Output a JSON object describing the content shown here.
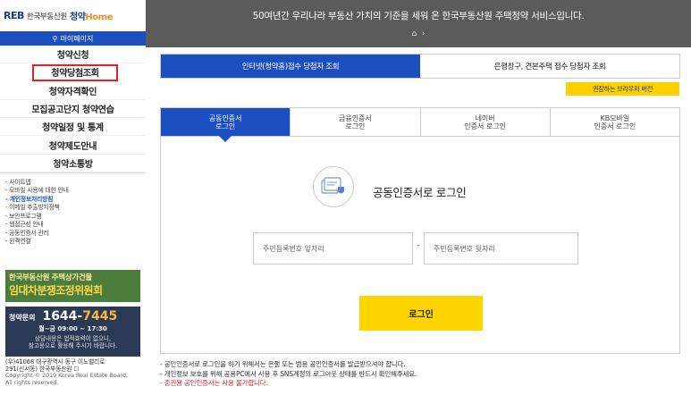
{
  "logo": {
    "mark": "REB",
    "agency": "한국부동산원",
    "brand_a": "청약",
    "brand_b": "Home"
  },
  "sidebar": {
    "mypage_label": "마이페이지",
    "menu": [
      {
        "label": "청약신청"
      },
      {
        "label": "청약당첨조회",
        "active": true
      },
      {
        "label": "청약자격확인"
      },
      {
        "label": "모집공고단지 청약연습"
      },
      {
        "label": "청약일정 및 통계"
      },
      {
        "label": "청약제도안내"
      },
      {
        "label": "청약소통방"
      }
    ],
    "links": [
      "사이트맵",
      "모바일 사용에 대한 안내",
      "개인정보처리방침",
      "이메일 추출방지정책",
      "보안프로그램",
      "웹접근성 안내",
      "공동인증서 관리",
      "원격연결"
    ],
    "banner": {
      "line1": "한국부동산원 주택상가건물",
      "line2": "임대차분쟁조정위원회"
    },
    "call": {
      "title": "청약문의",
      "num_a": "1644-",
      "num_b": "7445",
      "hours": "월~금 09:00 ~ 17:30",
      "note1": "상담내용은 법적효력이 없으니,",
      "note2": "참고용으로 활용해 주시기 바랍니다."
    },
    "address1": "(우)41068 대구광역시 동구 이노밸리로",
    "address2": "291(신서동) 한국부동산원 ☐",
    "copy1": "Copyright © 2019 Korea Real Estate Board,",
    "copy2": "All rights reserved."
  },
  "header": {
    "message": "50여년간 우리나라 부동산 가치의 기준을 세워 온 한국부동산원 주택청약 서비스입니다.",
    "home_icon": "home-icon"
  },
  "main": {
    "top_tabs": [
      {
        "label": "인터넷(청약홈)접수 당첨자 조회",
        "active": true
      },
      {
        "label": "은행창구, 견본주택 접수 당첨자 조회",
        "active": false
      }
    ],
    "browser_button": "권장하는 브라우저 버전",
    "cert_tabs": [
      {
        "label": "공동인증서\n로그인",
        "active": true
      },
      {
        "label": "금융인증서\n로그인",
        "active": false
      },
      {
        "label": "네이버\n인증서 로그인",
        "active": false
      },
      {
        "label": "KB모바일\n인증서 로그인",
        "active": false
      }
    ],
    "cert_title": "공동인증서로 로그인",
    "id_front_placeholder": "주민등록번호 앞자리",
    "id_back_placeholder": "주민등록번호 뒷자리",
    "dash": "-",
    "login_button": "로그인",
    "notes": [
      {
        "text": "- 공인인증서로 로그인을 하기 위해서는 은행 또는 범용 공인인증서를 발급받으셔야 합니다.",
        "red": false
      },
      {
        "text": "- 개인정보 보호를 위해 공용PC에서 사용 후 SNS계정의 로그아웃 상태를 반드시 확인해주세요.",
        "red": false
      },
      {
        "text": "- 증권용 공인인증서는 사용 불가합니다.",
        "red": true
      }
    ]
  },
  "colors": {
    "primary": "#1b4fbf",
    "accent_yellow": "#ffd500",
    "header_gray": "#5b5b5b",
    "highlight_red": "#e4212b"
  }
}
